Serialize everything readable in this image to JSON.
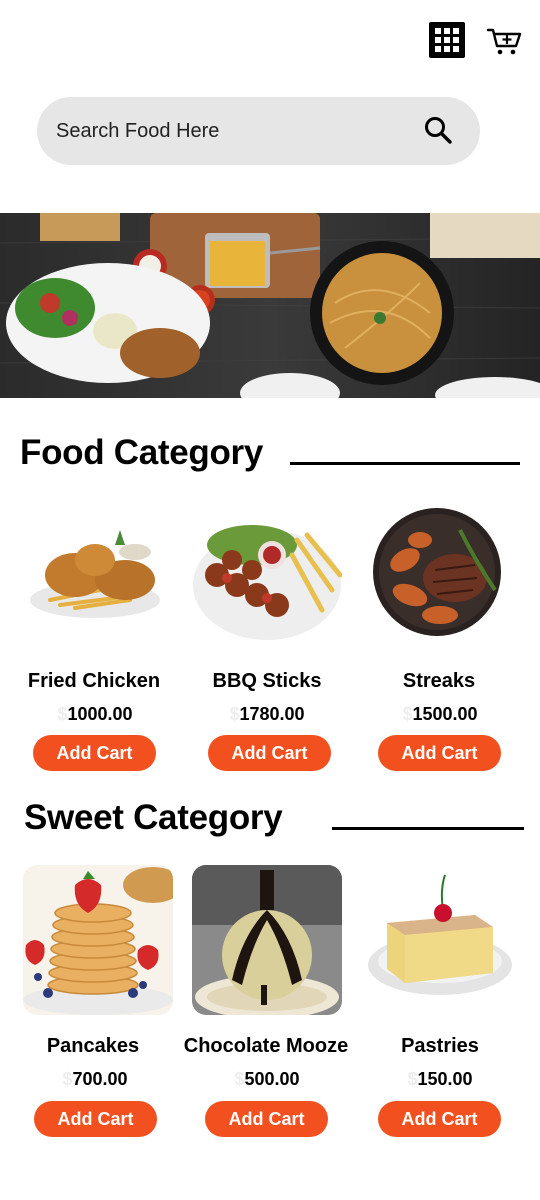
{
  "header": {
    "grid_icon": "grid-icon",
    "cart_icon": "cart-add-icon"
  },
  "search": {
    "placeholder": "Search Food Here",
    "icon": "search-icon"
  },
  "food_category": {
    "title": "Food Category",
    "items": [
      {
        "name": "Fried Chicken",
        "currency": "$",
        "price": "1000.00",
        "button": "Add Cart"
      },
      {
        "name": "BBQ Sticks",
        "currency": "$",
        "price": "1780.00",
        "button": "Add Cart"
      },
      {
        "name": "Streaks",
        "currency": "$",
        "price": "1500.00",
        "button": "Add Cart"
      }
    ]
  },
  "sweet_category": {
    "title": "Sweet Category",
    "items": [
      {
        "name": "Pancakes",
        "currency": "$",
        "price": "700.00",
        "button": "Add Cart"
      },
      {
        "name": "Chocolate Mooze",
        "currency": "$",
        "price": "500.00",
        "button": "Add Cart"
      },
      {
        "name": "Pastries",
        "currency": "$",
        "price": "150.00",
        "button": "Add Cart"
      }
    ]
  },
  "colors": {
    "accent": "#f2511f",
    "search_bg": "#e6e6e6",
    "text": "#000000"
  }
}
